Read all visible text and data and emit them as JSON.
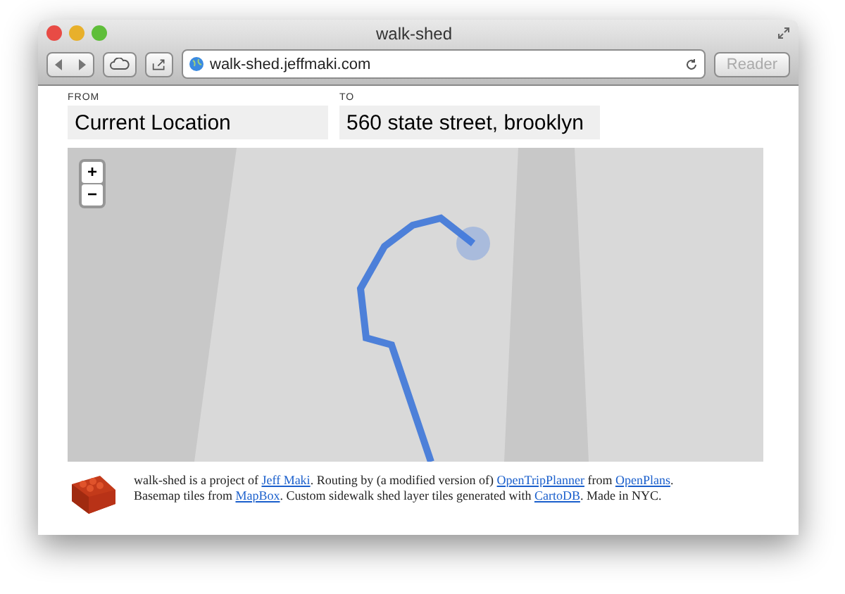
{
  "window": {
    "title": "walk-shed"
  },
  "toolbar": {
    "url": "walk-shed.jeffmaki.com",
    "reader_button": "Reader"
  },
  "form": {
    "from": {
      "label": "FROM",
      "value": "Current Location"
    },
    "to": {
      "label": "TO",
      "value": "560 state street, brooklyn"
    }
  },
  "map": {
    "zoom_in": "+",
    "zoom_out": "−"
  },
  "footer": {
    "segments": [
      {
        "text": "walk-shed is a project of ",
        "link": false
      },
      {
        "text": "Jeff Maki",
        "link": true
      },
      {
        "text": ". Routing by (a modified version of) ",
        "link": false
      },
      {
        "text": "OpenTripPlanner",
        "link": true
      },
      {
        "text": " from ",
        "link": false
      },
      {
        "text": "OpenPlans",
        "link": true
      },
      {
        "text": ". Basemap tiles from ",
        "link": false
      },
      {
        "text": "MapBox",
        "link": true
      },
      {
        "text": ". Custom sidewalk shed layer tiles generated with ",
        "link": false
      },
      {
        "text": "CartoDB",
        "link": true
      },
      {
        "text": ". Made in NYC.",
        "link": false
      }
    ]
  }
}
